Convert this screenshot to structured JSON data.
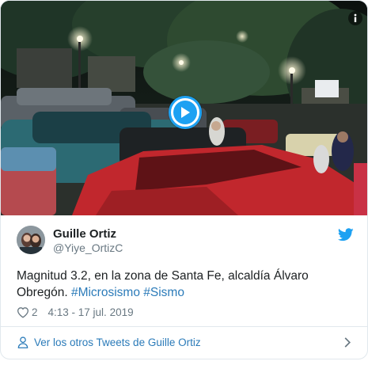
{
  "video": {
    "play_label": "Play",
    "info_label": "i"
  },
  "author": {
    "display_name": "Guille Ortiz",
    "handle": "@Yiye_OrtizC"
  },
  "tweet": {
    "text": "Magnitud 3.2, en la zona de Santa Fe, alcaldía Álvaro Obregón.",
    "hashtags": [
      "#Microsismo",
      "#Sismo"
    ]
  },
  "meta": {
    "likes": "2",
    "timestamp": "4:13 - 17 jul. 2019"
  },
  "footer": {
    "link_text": "Ver los otros Tweets de Guille Ortiz"
  },
  "colors": {
    "accent": "#1da1f2",
    "link": "#2b7bb9",
    "secondary_text": "#697882",
    "border": "#e1e8ed"
  },
  "icons": [
    "play-icon",
    "info-icon",
    "twitter-bird-icon",
    "heart-icon",
    "person-icon",
    "chevron-right-icon"
  ]
}
